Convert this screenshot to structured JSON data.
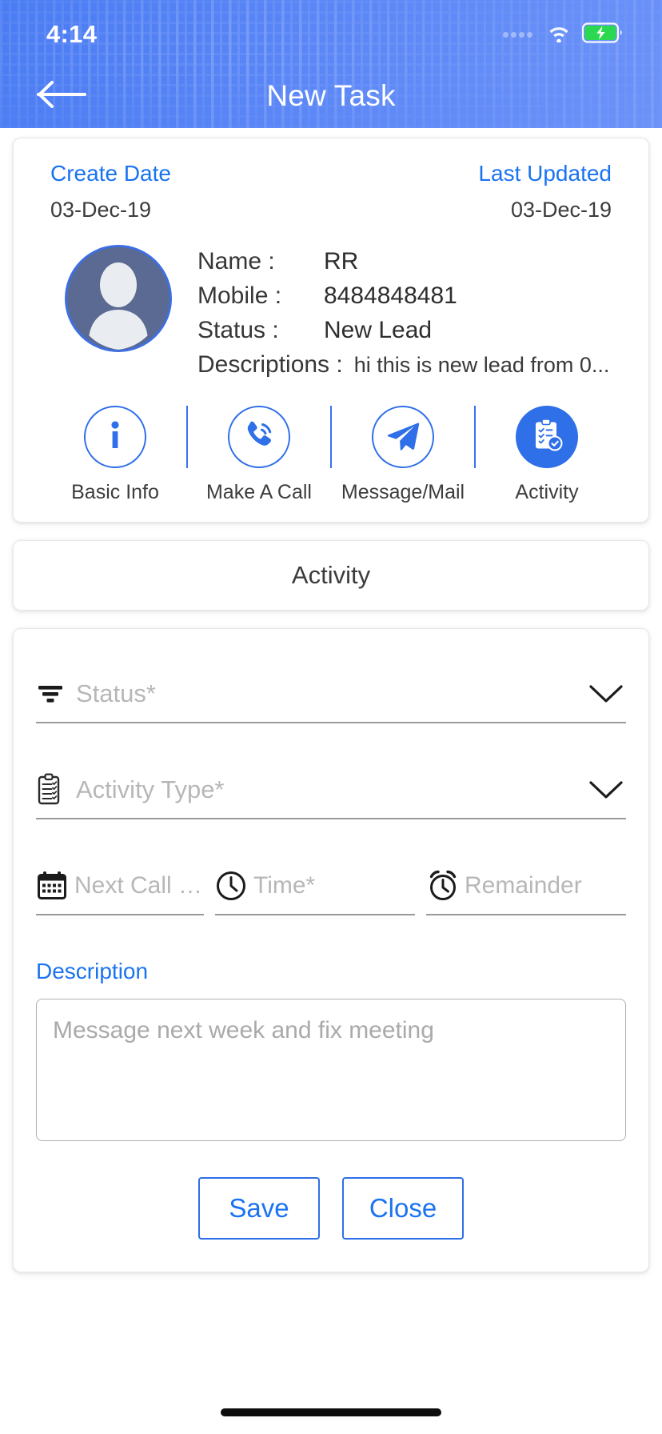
{
  "status_bar": {
    "time": "4:14",
    "wifi_icon": "wifi-icon",
    "battery_icon": "battery-charging-icon"
  },
  "header": {
    "back_icon": "arrow-left-icon",
    "title": "New Task",
    "accent_color": "#4a7cf3"
  },
  "profile": {
    "create_date_label": "Create Date",
    "create_date_value": "03-Dec-19",
    "last_updated_label": "Last Updated",
    "last_updated_value": "03-Dec-19",
    "avatar_icon": "avatar-person-icon",
    "fields": [
      {
        "key": "Name  :",
        "value": "RR"
      },
      {
        "key": "Mobile :",
        "value": "8484848481"
      },
      {
        "key": "Status  :",
        "value": "New Lead"
      }
    ],
    "description_key": "Descriptions :",
    "description_value": "hi this is new lead from 0...",
    "actions": [
      {
        "label": "Basic Info",
        "icon": "info-circle-icon",
        "active": false
      },
      {
        "label": "Make A Call",
        "icon": "phone-call-icon",
        "active": false
      },
      {
        "label": "Message/Mail",
        "icon": "paper-plane-icon",
        "active": false
      },
      {
        "label": "Activity",
        "icon": "clipboard-check-icon",
        "active": true
      }
    ]
  },
  "activity_section": {
    "title": "Activity"
  },
  "form": {
    "status_field": {
      "placeholder": "Status*",
      "icon": "filter-lines-icon",
      "dropdown_icon": "chevron-down-icon",
      "value": ""
    },
    "activity_type_field": {
      "placeholder": "Activity Type*",
      "icon": "clipboard-list-icon",
      "dropdown_icon": "chevron-down-icon",
      "value": ""
    },
    "next_call_date_field": {
      "placeholder": "Next Call da...",
      "icon": "calendar-icon",
      "value": ""
    },
    "time_field": {
      "placeholder": "Time*",
      "icon": "clock-icon",
      "value": ""
    },
    "remainder_field": {
      "placeholder": "Remainder",
      "icon": "alarm-clock-icon",
      "value": ""
    },
    "description": {
      "label": "Description",
      "placeholder": "Message next week and fix meeting",
      "value": ""
    },
    "save_label": "Save",
    "close_label": "Close",
    "link_color": "#1a73f0"
  }
}
